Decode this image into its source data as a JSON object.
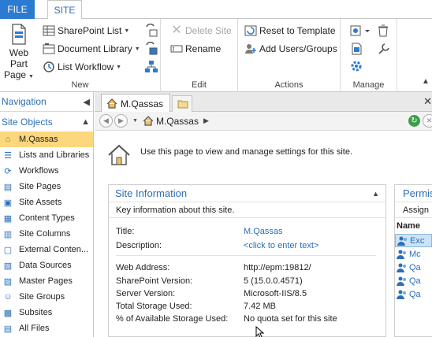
{
  "ribbon_tabs": {
    "file": "FILE",
    "site": "SITE"
  },
  "ribbon": {
    "new": {
      "label": "New",
      "web_part_page": "Web Part Page",
      "sharepoint_list": "SharePoint List",
      "document_library": "Document Library",
      "list_workflow": "List Workflow"
    },
    "edit": {
      "label": "Edit",
      "delete_site": "Delete Site",
      "rename": "Rename"
    },
    "actions": {
      "label": "Actions",
      "reset_to_template": "Reset to Template",
      "add_users_groups": "Add Users/Groups"
    },
    "manage": {
      "label": "Manage"
    }
  },
  "navigation": {
    "header": "Navigation",
    "section": "Site Objects",
    "items": [
      {
        "label": "M.Qassas",
        "icon": "home-icon"
      },
      {
        "label": "Lists and Libraries",
        "icon": "list-icon"
      },
      {
        "label": "Workflows",
        "icon": "workflow-icon"
      },
      {
        "label": "Site Pages",
        "icon": "pages-icon"
      },
      {
        "label": "Site Assets",
        "icon": "assets-icon"
      },
      {
        "label": "Content Types",
        "icon": "content-types-icon"
      },
      {
        "label": "Site Columns",
        "icon": "columns-icon"
      },
      {
        "label": "External Conten...",
        "icon": "external-content-icon"
      },
      {
        "label": "Data Sources",
        "icon": "data-sources-icon"
      },
      {
        "label": "Master Pages",
        "icon": "master-pages-icon"
      },
      {
        "label": "Site Groups",
        "icon": "groups-icon"
      },
      {
        "label": "Subsites",
        "icon": "subsites-icon"
      },
      {
        "label": "All Files",
        "icon": "files-icon"
      }
    ]
  },
  "doc_tab": {
    "label": "M.Qassas"
  },
  "address": {
    "crumb": "M.Qassas"
  },
  "intro_text": "Use this page to view and manage settings for this site.",
  "site_info": {
    "title": "Site Information",
    "subtitle": "Key information about this site.",
    "fields": {
      "title_label": "Title:",
      "title_value": "M.Qassas",
      "description_label": "Description:",
      "description_value": "<click to enter text>",
      "web_address_label": "Web Address:",
      "web_address_value": "http://epm:19812/",
      "sp_version_label": "SharePoint Version:",
      "sp_version_value": "5 (15.0.0.4571)",
      "server_version_label": "Server Version:",
      "server_version_value": "Microsoft-IIS/8.5",
      "storage_label": "Total Storage Used:",
      "storage_value": "7.42 MB",
      "quota_label": "% of Available Storage Used:",
      "quota_value": "No quota set for this site"
    }
  },
  "permissions": {
    "title": "Permissions",
    "subtitle": "Assign",
    "column": "Name",
    "rows": [
      "Exc",
      "Mc",
      "Qa",
      "Qa",
      "Qa"
    ]
  },
  "colors": {
    "accent": "#2b7bd0",
    "link": "#2b6fb7",
    "nav_active": "#fcd77e"
  }
}
